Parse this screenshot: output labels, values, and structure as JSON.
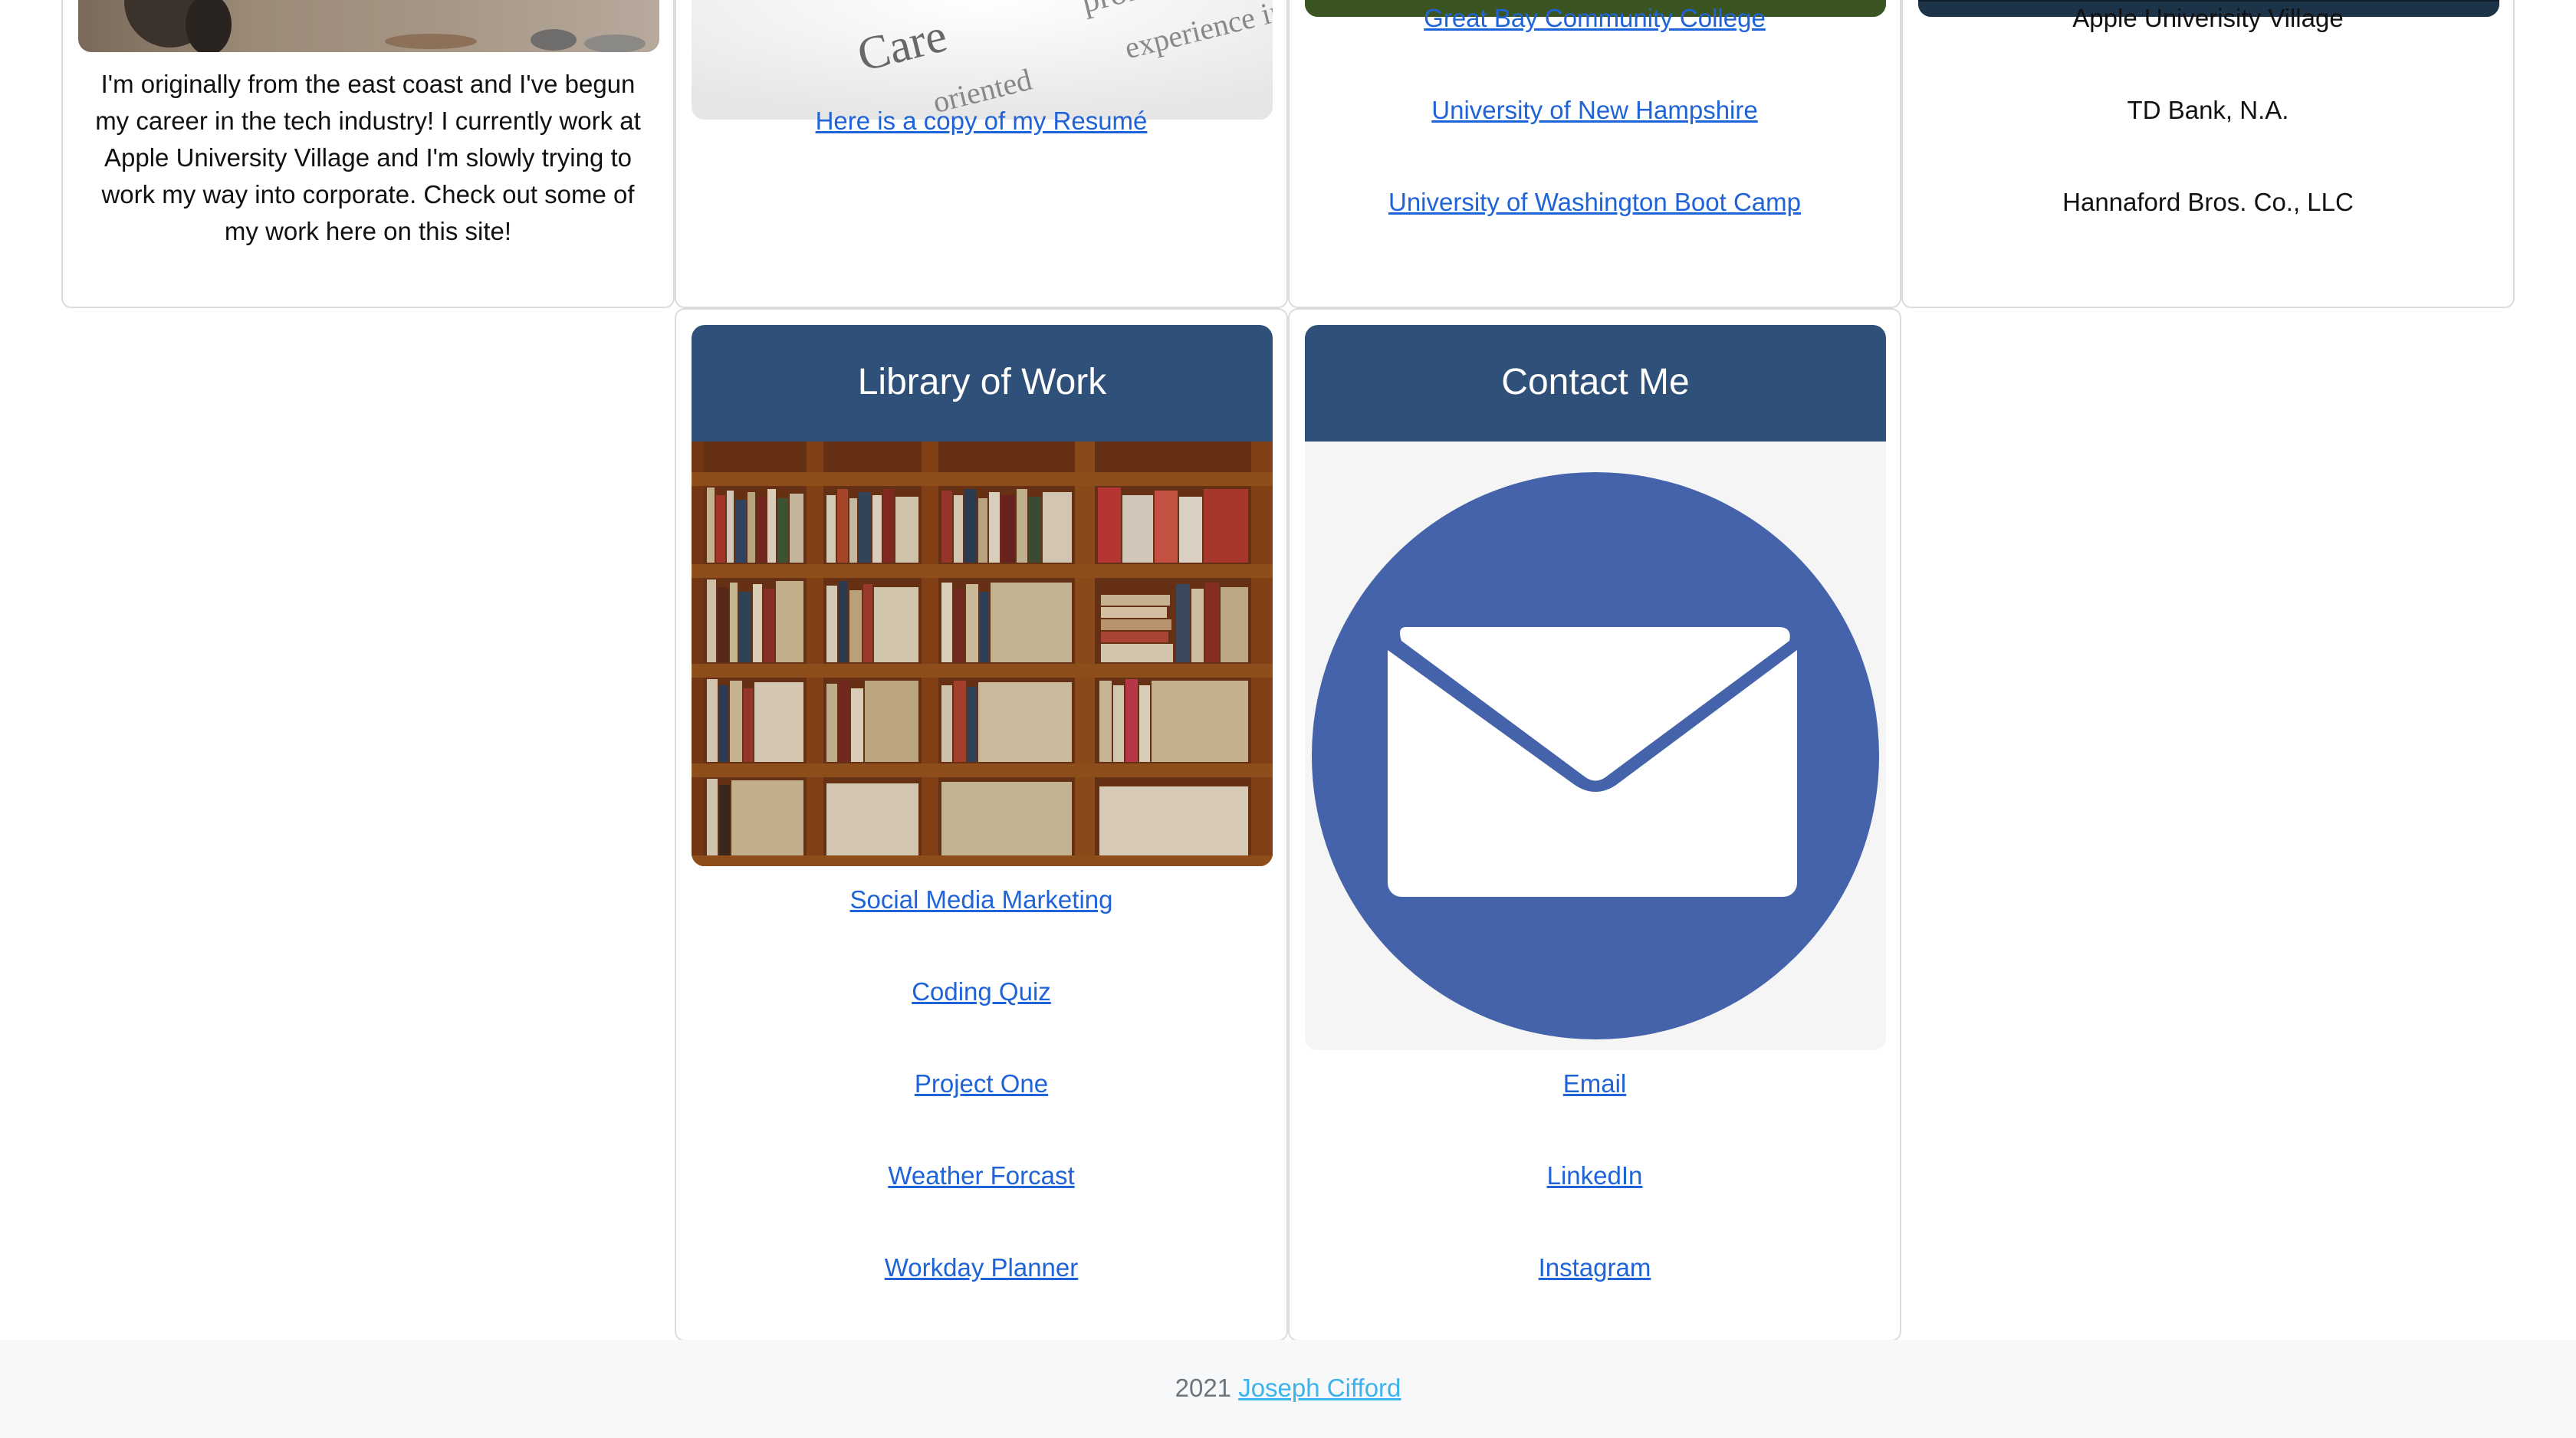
{
  "about": {
    "text_lines": [
      "I'm originally from the east coast and I've begun",
      "my career in the tech industry! I currently work at",
      "Apple University Village and I'm slowly trying to",
      "work my way into corporate. Check out some of",
      "my work here on this site!"
    ]
  },
  "resume": {
    "image_words": [
      "Care",
      "professiona",
      "oriented",
      "experience in"
    ],
    "link_label": "Here is a copy of my Resumé"
  },
  "education": {
    "links": [
      "Great Bay Community College",
      "University of New Hampshire",
      "University of Washington Boot Camp"
    ]
  },
  "experience": {
    "items": [
      "Apple Univerisity Village",
      "TD Bank, N.A.",
      "Hannaford Bros. Co., LLC"
    ]
  },
  "library": {
    "title": "Library of Work",
    "links": [
      "Social Media Marketing",
      "Coding Quiz",
      "Project One",
      "Weather Forcast",
      "Workday Planner"
    ]
  },
  "contact": {
    "title": "Contact Me",
    "links": [
      "Email",
      "LinkedIn",
      "Instagram"
    ]
  },
  "footer": {
    "year": "2021",
    "author": "Joseph Cifford"
  },
  "colors": {
    "header_blue": "#2e5079",
    "link_blue": "#1f63d8",
    "mail_circle": "#4563aa",
    "footer_link": "#3cb3ea"
  }
}
